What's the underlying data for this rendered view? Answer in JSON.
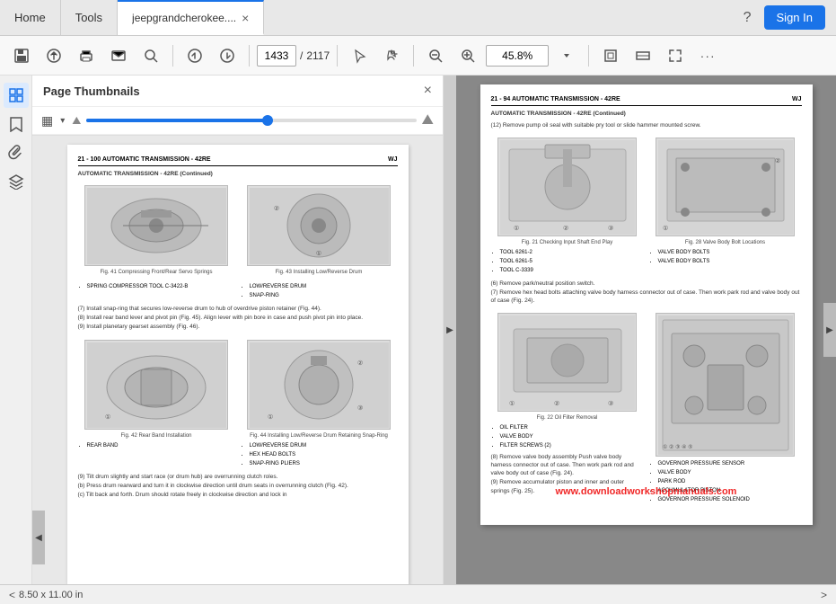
{
  "nav": {
    "home_label": "Home",
    "tools_label": "Tools",
    "active_tab_label": "jeepgrandcherokee....",
    "close_icon": "×",
    "help_icon": "?",
    "sign_in_label": "Sign In"
  },
  "toolbar": {
    "save_icon": "💾",
    "upload_icon": "⬆",
    "print_icon": "🖨",
    "email_icon": "✉",
    "search_icon": "🔍",
    "up_icon": "⬆",
    "down_icon": "⬇",
    "page_current": "1433",
    "page_separator": "/",
    "page_total": "2117",
    "cursor_icon": "↖",
    "pan_icon": "✋",
    "zoom_out_icon": "−",
    "zoom_in_icon": "+",
    "zoom_value": "45.8%",
    "fit_page_icon": "⊞",
    "fit_width_icon": "⊟",
    "full_screen_icon": "⛶",
    "more_icon": "···"
  },
  "sidebar": {
    "thumbnails_icon": "📄",
    "bookmark_icon": "🔖",
    "paperclip_icon": "📎",
    "layers_icon": "⊞"
  },
  "thumbnails_panel": {
    "title": "Page Thumbnails",
    "close_icon": "×",
    "grid_icon": "▦",
    "dropdown_icon": "▾",
    "slider_min_icon": "⛰",
    "slider_max_icon": "⛰"
  },
  "left_page": {
    "header_left": "21 - 100   AUTOMATIC TRANSMISSION - 42RE",
    "header_right": "WJ",
    "subheader": "AUTOMATIC TRANSMISSION - 42RE (Continued)",
    "fig41_caption": "Fig. 41 Compressing Front/Rear Servo Springs",
    "fig41_labels": [
      "1 - SPRING COMPRESSOR TOOL C-3422-B"
    ],
    "fig42_caption": "Fig. 42 Rear Band Installation",
    "fig42_labels": [
      "1 - REAR BAND"
    ],
    "fig43_caption": "Fig. 43 Installing Low/Reverse Drum",
    "fig43_labels": [
      "1 - LOW/REVERSE DRUM",
      "2 - SNAP-RING"
    ],
    "fig44_caption": "Fig. 44 Installing Low/Reverse Drum Retaining Snap-Ring",
    "fig44_labels": [
      "1 - LOW/REVERSE DRUM",
      "2 - HEX HEAD BOLTS",
      "3 - SNAP-RING PLIERS"
    ],
    "step7": "(7) Install snap-ring that secures low-reverse drum to hub of overdrive piston retainer (Fig. 44).",
    "step8": "(8) Install rear band lever and pivot pin (Fig. 45). Align lever with pin bore in case and push pivot pin into place.",
    "step9": "(9) Install planetary gearset assembly (Fig. 46).",
    "step_tilt": "(9) Tilt drum slightly and start race (or drum hub) are overrunning clutch roles.",
    "step_rotate": "(b) Press drum rearward and turn it in clockwise direction until drum seats in overrunning clutch (Fig. 42).",
    "step_check": "(c) Tilt back and forth. Drum should rotate freely in clockwise direction and lock in"
  },
  "right_page": {
    "header_left": "21 - 94   AUTOMATIC TRANSMISSION - 42RE",
    "header_right": "WJ",
    "subheader": "AUTOMATIC TRANSMISSION - 42RE (Continued)",
    "step12": "(12) Remove pump oil seal with suitable pry tool or slide hammer mounted screw.",
    "fig21_caption": "Fig. 21 Checking Input Shaft End Play",
    "fig21_labels": [
      "1 - TOOL 6261-2",
      "2 - TOOL 6261-5",
      "3 - TOOL C-3339"
    ],
    "fig22_caption": "Fig. 22 Oil Filter Removal",
    "fig22_labels": [
      "1 - OIL FILTER",
      "2 - VALVE BODY",
      "3 - FILTER SCREWS (2)"
    ],
    "fig28_caption": "Fig. 28 Valve Body Bolt Locations",
    "fig28_labels": [
      "1 - VALVE BODY BOLTS",
      "2 - VALVE BODY BOLTS"
    ],
    "step6": "(6) Remove park/neutral position switch.",
    "step7": "(7) Remove hex head bolts attaching valve body harness connector out of case. Then work park rod and valve body out of case (Fig. 24).",
    "step8": "(8) Remove valve body assembly Push valve body harness connector out of case. Then work park rod and valve body out of case (Fig. 24).",
    "step9": "(9) Remove accumulator piston and inner and outer springs (Fig. 25).",
    "fig_right_labels": [
      "1 - GOVERNOR PRESSURE SENSOR",
      "2 - VALVE BODY",
      "3 - PARK ROD",
      "4 - ACCUMULATOR PISTON",
      "5 - GOVERNOR PRESSURE SOLENOID"
    ],
    "watermark": "www.downloadworkshopmanuals.com"
  },
  "status_bar": {
    "page_size": "8.50 x 11.00 in",
    "left_arrow": "<",
    "right_arrow": ">"
  }
}
